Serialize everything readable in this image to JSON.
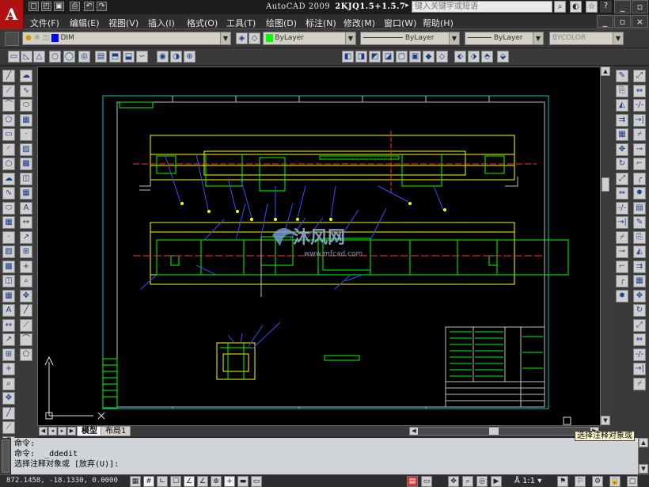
{
  "app": {
    "logo": "A",
    "title": "AutoCAD 2009",
    "file_name": "2KJQ1.5+1.5.7",
    "search_placeholder": "键入关键字或短语"
  },
  "menu": [
    "文件(F)",
    "编辑(E)",
    "视图(V)",
    "插入(I)",
    "格式(O)",
    "工具(T)",
    "绘图(D)",
    "标注(N)",
    "修改(M)",
    "窗口(W)",
    "帮助(H)"
  ],
  "layers": {
    "current_layer": "DIM",
    "color": "ByLayer",
    "linetype": "ByLayer",
    "lineweight": "ByLayer",
    "plotstyle": "BYCOLOR"
  },
  "watermark": {
    "brand": "沐风网",
    "url": "www.mfcad.com"
  },
  "tabs": {
    "model": "模型",
    "layout1": "布局1"
  },
  "command": {
    "line1": "命令:",
    "line2": "命令:  _ddedit",
    "line3": "选择注释对象或 [放弃(U)]:"
  },
  "tooltip": "选择注释对象或",
  "status": {
    "coordinates": "872.1458, -18.1330, 0.0000",
    "annotation_scale": "1:1"
  },
  "colors": {
    "canvas": "#000000",
    "border": "#00c8c8",
    "geometry_yellow": "#ffff00",
    "geometry_green": "#00ff00",
    "leader_blue": "#3a4cff"
  }
}
